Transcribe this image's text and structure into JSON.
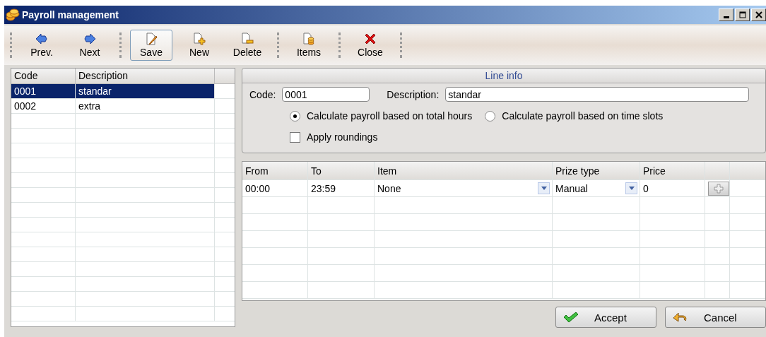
{
  "window": {
    "title": "Payroll management"
  },
  "toolbar": [
    {
      "kind": "separator"
    },
    {
      "kind": "prev",
      "label": "Prev.",
      "selected": false
    },
    {
      "kind": "next",
      "label": "Next",
      "selected": false
    },
    {
      "kind": "separator"
    },
    {
      "kind": "save",
      "label": "Save",
      "selected": true
    },
    {
      "kind": "new",
      "label": "New",
      "selected": false
    },
    {
      "kind": "delete",
      "label": "Delete",
      "selected": false
    },
    {
      "kind": "separator"
    },
    {
      "kind": "items",
      "label": "Items",
      "selected": false
    },
    {
      "kind": "separator"
    },
    {
      "kind": "close",
      "label": "Close",
      "selected": false
    },
    {
      "kind": "separator"
    }
  ],
  "list": {
    "columns": [
      "Code",
      "Description"
    ],
    "rows": [
      {
        "code": "0001",
        "description": "standar",
        "selected": true
      },
      {
        "code": "0002",
        "description": "extra",
        "selected": false
      }
    ]
  },
  "line_info": {
    "title": "Line info",
    "code_label": "Code:",
    "code": "0001",
    "description_label": "Description:",
    "description": "standar",
    "calculation": [
      {
        "label": "Calculate payroll based on total hours",
        "selected": true
      },
      {
        "label": "Calculate payroll based on time slots",
        "selected": false
      }
    ],
    "roundings": {
      "label": "Apply roundings",
      "checked": false
    }
  },
  "slots": {
    "columns": [
      "From",
      "To",
      "Item",
      "Prize type",
      "Price"
    ],
    "rows": [
      {
        "cells": [
          {
            "kind": "text",
            "value": "00:00"
          },
          {
            "kind": "text",
            "value": "23:59"
          },
          {
            "kind": "dropdown",
            "value": "None"
          },
          {
            "kind": "dropdown",
            "value": "Manual"
          },
          {
            "kind": "text",
            "value": "0"
          }
        ]
      }
    ]
  },
  "buttons": [
    {
      "kind": "accept",
      "label": "Accept"
    },
    {
      "kind": "cancel",
      "label": "Cancel"
    }
  ]
}
